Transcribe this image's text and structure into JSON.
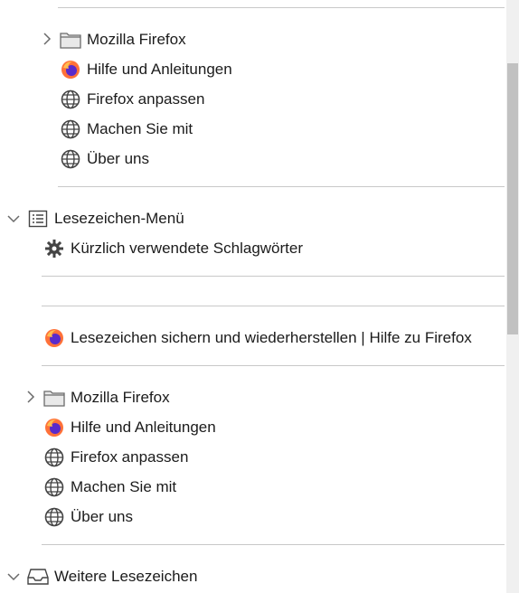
{
  "tree": {
    "group1": {
      "items": [
        {
          "label": "Mozilla Firefox",
          "icon": "folder-icon"
        },
        {
          "label": "Hilfe und Anleitungen",
          "icon": "firefox-icon"
        },
        {
          "label": "Firefox anpassen",
          "icon": "globe-icon"
        },
        {
          "label": "Machen Sie mit",
          "icon": "globe-icon"
        },
        {
          "label": "Über uns",
          "icon": "globe-icon"
        }
      ]
    },
    "menu": {
      "label": "Lesezeichen-Menü",
      "recent_tags": "Kürzlich verwendete Schlagwörter",
      "backup_link": "Lesezeichen sichern und wiederherstellen | Hilfe zu Firefox"
    },
    "group2": {
      "items": [
        {
          "label": "Mozilla Firefox",
          "icon": "folder-icon"
        },
        {
          "label": "Hilfe und Anleitungen",
          "icon": "firefox-icon"
        },
        {
          "label": "Firefox anpassen",
          "icon": "globe-icon"
        },
        {
          "label": "Machen Sie mit",
          "icon": "globe-icon"
        },
        {
          "label": "Über uns",
          "icon": "globe-icon"
        }
      ]
    },
    "other": {
      "label": "Weitere Lesezeichen"
    }
  }
}
